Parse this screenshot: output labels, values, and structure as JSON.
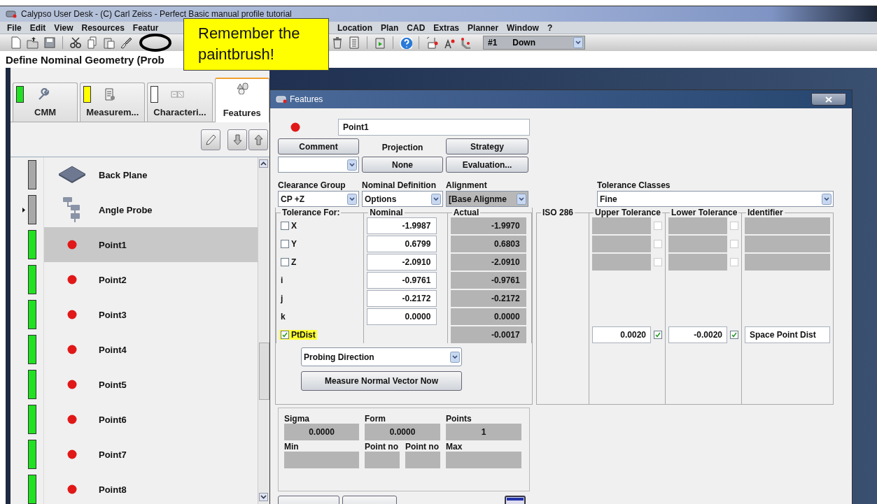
{
  "window": {
    "title": "Calypso User Desk - (C) Carl Zeiss - Perfect Basic manual profile tutorial"
  },
  "menu": [
    {
      "label": "File"
    },
    {
      "label": "Edit"
    },
    {
      "label": "View"
    },
    {
      "label": "Resources"
    },
    {
      "label": "Featur"
    },
    {
      "label": "Location"
    },
    {
      "label": "Plan"
    },
    {
      "label": "CAD"
    },
    {
      "label": "Extras"
    },
    {
      "label": "Planner"
    },
    {
      "label": "Window"
    },
    {
      "label": "?"
    }
  ],
  "toolbar": {
    "probe_number": "#1",
    "probe_direction": "Down"
  },
  "header": {
    "title": "Define Nominal Geometry (Prob"
  },
  "tabs": [
    {
      "label": "CMM",
      "color": "#22e022",
      "selected": false
    },
    {
      "label": "Measurem...",
      "color": "#ffff00",
      "selected": false
    },
    {
      "label": "Characteri...",
      "color": "#ffffff",
      "selected": false
    },
    {
      "label": "Features",
      "selected": true
    }
  ],
  "features": [
    {
      "name": "Back Plane",
      "kind": "plane",
      "color": "#a8a8a8",
      "selected": false
    },
    {
      "name": "Angle Probe",
      "kind": "group",
      "color": "#a8a8a8",
      "selected": false
    },
    {
      "name": "Point1",
      "kind": "point",
      "color": "#22e022",
      "selected": true
    },
    {
      "name": "Point2",
      "kind": "point",
      "color": "#22e022",
      "selected": false
    },
    {
      "name": "Point3",
      "kind": "point",
      "color": "#22e022",
      "selected": false
    },
    {
      "name": "Point4",
      "kind": "point",
      "color": "#22e022",
      "selected": false
    },
    {
      "name": "Point5",
      "kind": "point",
      "color": "#22e022",
      "selected": false
    },
    {
      "name": "Point6",
      "kind": "point",
      "color": "#22e022",
      "selected": false
    },
    {
      "name": "Point7",
      "kind": "point",
      "color": "#22e022",
      "selected": false
    },
    {
      "name": "Point8",
      "kind": "point",
      "color": "#22e022",
      "selected": false
    }
  ],
  "dialog": {
    "title": "Features",
    "name": "Point1",
    "comment_button": "Comment",
    "projection_label": "Projection",
    "projection_value": "None",
    "strategy_button": "Strategy",
    "evaluation_button": "Evaluation...",
    "clearance_group": {
      "label": "Clearance Group",
      "value": "CP +Z"
    },
    "nominal_definition": {
      "label": "Nominal Definition",
      "value": "Options"
    },
    "alignment": {
      "label": "Alignment",
      "value": "[Base Alignme"
    },
    "tolerance_classes": {
      "label": "Tolerance Classes",
      "value": "Fine"
    },
    "columns": {
      "tolerance_for": "Tolerance For:",
      "nominal": "Nominal",
      "actual": "Actual",
      "iso": "ISO 286",
      "upper": "Upper Tolerance",
      "lower": "Lower Tolerance",
      "identifier": "Identifier"
    },
    "rows": [
      {
        "kind": "check",
        "label": "X",
        "checked": false,
        "highlighted": false,
        "nominal": "-1.9987",
        "actual": "-1.9970",
        "tolerance": {
          "enabled": false,
          "upper_checked": false,
          "lower_checked": false
        }
      },
      {
        "kind": "check",
        "label": "Y",
        "checked": false,
        "highlighted": false,
        "nominal": "0.6799",
        "actual": "0.6803",
        "tolerance": {
          "enabled": false,
          "upper_checked": false,
          "lower_checked": false
        }
      },
      {
        "kind": "check",
        "label": "Z",
        "checked": false,
        "highlighted": false,
        "nominal": "-2.0910",
        "actual": "-2.0910",
        "tolerance": {
          "enabled": false,
          "upper_checked": false,
          "lower_checked": false
        }
      },
      {
        "kind": "plain",
        "label": "i",
        "highlighted": false,
        "nominal": "-0.9761",
        "actual": "-0.9761"
      },
      {
        "kind": "plain",
        "label": "j",
        "highlighted": false,
        "nominal": "-0.2172",
        "actual": "-0.2172"
      },
      {
        "kind": "plain",
        "label": "k",
        "highlighted": false,
        "nominal": "0.0000",
        "actual": "0.0000"
      },
      {
        "kind": "check",
        "label": "PtDist",
        "checked": true,
        "highlighted": true,
        "actual": "-0.0017",
        "tolerance": {
          "enabled": true,
          "upper": "0.0020",
          "upper_checked": true,
          "lower": "-0.0020",
          "lower_checked": true,
          "identifier": "Space Point Dist"
        }
      }
    ],
    "probing_direction": "Probing Direction",
    "measure_button": "Measure Normal Vector Now",
    "stats_top": [
      {
        "label": "Sigma",
        "value": "0.0000"
      },
      {
        "label": "Form",
        "value": "0.0000"
      },
      {
        "label": "Points",
        "value": "1"
      }
    ],
    "stats_bottom": [
      {
        "label": "Min"
      },
      {
        "label": "Point no"
      },
      {
        "label": "Point no"
      },
      {
        "label": "Max"
      }
    ]
  },
  "callout": {
    "text": "Remember the paintbrush!"
  }
}
